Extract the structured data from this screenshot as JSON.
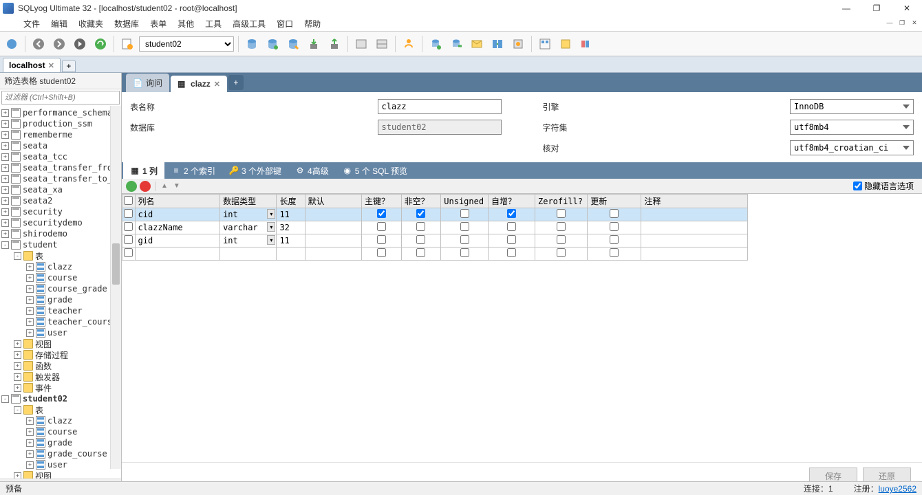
{
  "window": {
    "title": "SQLyog Ultimate 32 - [localhost/student02 - root@localhost]",
    "min": "—",
    "max": "❐",
    "close": "✕"
  },
  "menu": [
    "文件",
    "编辑",
    "收藏夹",
    "数据库",
    "表单",
    "其他",
    "工具",
    "高级工具",
    "窗口",
    "帮助"
  ],
  "toolbar": {
    "db_selected": "student02"
  },
  "conn_tabs": {
    "active": "localhost",
    "add": "+"
  },
  "sidebar": {
    "header": "筛选表格 student02",
    "filter_placeholder": "过滤器 (Ctrl+Shift+B)",
    "nodes": [
      {
        "depth": 0,
        "exp": "+",
        "icon": "db",
        "label": "performance_schema"
      },
      {
        "depth": 0,
        "exp": "+",
        "icon": "db",
        "label": "production_ssm"
      },
      {
        "depth": 0,
        "exp": "+",
        "icon": "db",
        "label": "rememberme"
      },
      {
        "depth": 0,
        "exp": "+",
        "icon": "db",
        "label": "seata"
      },
      {
        "depth": 0,
        "exp": "+",
        "icon": "db",
        "label": "seata_tcc"
      },
      {
        "depth": 0,
        "exp": "+",
        "icon": "db",
        "label": "seata_transfer_from_"
      },
      {
        "depth": 0,
        "exp": "+",
        "icon": "db",
        "label": "seata_transfer_to_db"
      },
      {
        "depth": 0,
        "exp": "+",
        "icon": "db",
        "label": "seata_xa"
      },
      {
        "depth": 0,
        "exp": "+",
        "icon": "db",
        "label": "seata2"
      },
      {
        "depth": 0,
        "exp": "+",
        "icon": "db",
        "label": "security"
      },
      {
        "depth": 0,
        "exp": "+",
        "icon": "db",
        "label": "securitydemo"
      },
      {
        "depth": 0,
        "exp": "+",
        "icon": "db",
        "label": "shirodemo"
      },
      {
        "depth": 0,
        "exp": "-",
        "icon": "db",
        "label": "student"
      },
      {
        "depth": 1,
        "exp": "-",
        "icon": "folder",
        "label": "表"
      },
      {
        "depth": 2,
        "exp": "+",
        "icon": "table",
        "label": "clazz"
      },
      {
        "depth": 2,
        "exp": "+",
        "icon": "table",
        "label": "course"
      },
      {
        "depth": 2,
        "exp": "+",
        "icon": "table",
        "label": "course_grade"
      },
      {
        "depth": 2,
        "exp": "+",
        "icon": "table",
        "label": "grade"
      },
      {
        "depth": 2,
        "exp": "+",
        "icon": "table",
        "label": "teacher"
      },
      {
        "depth": 2,
        "exp": "+",
        "icon": "table",
        "label": "teacher_cours"
      },
      {
        "depth": 2,
        "exp": "+",
        "icon": "table",
        "label": "user"
      },
      {
        "depth": 1,
        "exp": "+",
        "icon": "folder",
        "label": "视图"
      },
      {
        "depth": 1,
        "exp": "+",
        "icon": "folder",
        "label": "存储过程"
      },
      {
        "depth": 1,
        "exp": "+",
        "icon": "folder",
        "label": "函数"
      },
      {
        "depth": 1,
        "exp": "+",
        "icon": "folder",
        "label": "触发器"
      },
      {
        "depth": 1,
        "exp": "+",
        "icon": "folder",
        "label": "事件"
      },
      {
        "depth": 0,
        "exp": "-",
        "icon": "db",
        "label": "student02",
        "bold": true
      },
      {
        "depth": 1,
        "exp": "-",
        "icon": "folder",
        "label": "表"
      },
      {
        "depth": 2,
        "exp": "+",
        "icon": "table",
        "label": "clazz"
      },
      {
        "depth": 2,
        "exp": "+",
        "icon": "table",
        "label": "course"
      },
      {
        "depth": 2,
        "exp": "+",
        "icon": "table",
        "label": "grade"
      },
      {
        "depth": 2,
        "exp": "+",
        "icon": "table",
        "label": "grade_course"
      },
      {
        "depth": 2,
        "exp": "+",
        "icon": "table",
        "label": "user"
      },
      {
        "depth": 1,
        "exp": "+",
        "icon": "folder",
        "label": "视图"
      }
    ]
  },
  "editor_tabs": [
    {
      "label": "询问",
      "active": false,
      "icon": "query"
    },
    {
      "label": "clazz",
      "active": true,
      "icon": "table"
    }
  ],
  "form": {
    "table_name_label": "表名称",
    "table_name": "clazz",
    "database_label": "数据库",
    "database": "student02",
    "engine_label": "引擎",
    "engine": "InnoDB",
    "charset_label": "字符集",
    "charset": "utf8mb4",
    "collation_label": "核对",
    "collation": "utf8mb4_croatian_ci"
  },
  "sub_tabs": [
    {
      "label": "1 列",
      "active": true
    },
    {
      "label": "2 个索引",
      "active": false
    },
    {
      "label": "3 个外部键",
      "active": false
    },
    {
      "label": "4高级",
      "active": false
    },
    {
      "label": "5 个 SQL 预览",
      "active": false
    }
  ],
  "hide_lang_label": "隐藏语言选项",
  "grid": {
    "headers": [
      "",
      "列名",
      "数据类型",
      "长度",
      "默认",
      "主键？",
      "非空？",
      "Unsigned",
      "自增？",
      "Zerofill?",
      "更新",
      "注释"
    ],
    "rows": [
      {
        "sel": true,
        "name": "cid",
        "type": "int",
        "len": "11",
        "def": "",
        "pk": true,
        "nn": true,
        "un": false,
        "ai": true,
        "zf": false,
        "upd": false,
        "cmt": ""
      },
      {
        "sel": false,
        "name": "clazzName",
        "type": "varchar",
        "len": "32",
        "def": "",
        "pk": false,
        "nn": false,
        "un": false,
        "ai": false,
        "zf": false,
        "upd": false,
        "cmt": ""
      },
      {
        "sel": false,
        "name": "gid",
        "type": "int",
        "len": "11",
        "def": "",
        "pk": false,
        "nn": false,
        "un": false,
        "ai": false,
        "zf": false,
        "upd": false,
        "cmt": ""
      },
      {
        "sel": false,
        "name": "",
        "type": "",
        "len": "",
        "def": "",
        "pk": false,
        "nn": false,
        "un": false,
        "ai": false,
        "zf": false,
        "upd": false,
        "cmt": "",
        "empty": true
      }
    ]
  },
  "footer": {
    "save": "保存",
    "revert": "还原"
  },
  "status": {
    "left": "预备",
    "conn": "连接：1",
    "reg_label": "注册：",
    "reg_user": "luoye2562"
  }
}
